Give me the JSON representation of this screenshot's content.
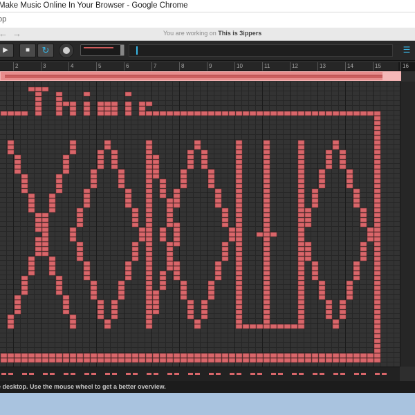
{
  "window": {
    "title": "Make Music Online In Your Browser - Google Chrome"
  },
  "browser": {
    "url_fragment": "op",
    "back_glyph": "←",
    "forward_glyph": "→"
  },
  "notice": {
    "prefix": "You are working on",
    "project_name": "This is 3ippers"
  },
  "toolbar": {
    "play_icon": "play-icon",
    "stop_icon": "stop-icon",
    "loop_icon": "loop-icon",
    "record_icon": "record-icon",
    "menu_icon": "hamburger-icon",
    "tempo_level": 0.82
  },
  "ruler": {
    "bars": [
      "2",
      "3",
      "4",
      "5",
      "6",
      "7",
      "8",
      "9",
      "10",
      "11",
      "12",
      "13",
      "14",
      "15",
      "16"
    ]
  },
  "status": {
    "text": "e desktop. Use the mouse wheel to get a better overview."
  },
  "colors": {
    "note": "#d9666a",
    "loop": "#e88c8c",
    "accent": "#38b8e8",
    "background": "#333333"
  }
}
